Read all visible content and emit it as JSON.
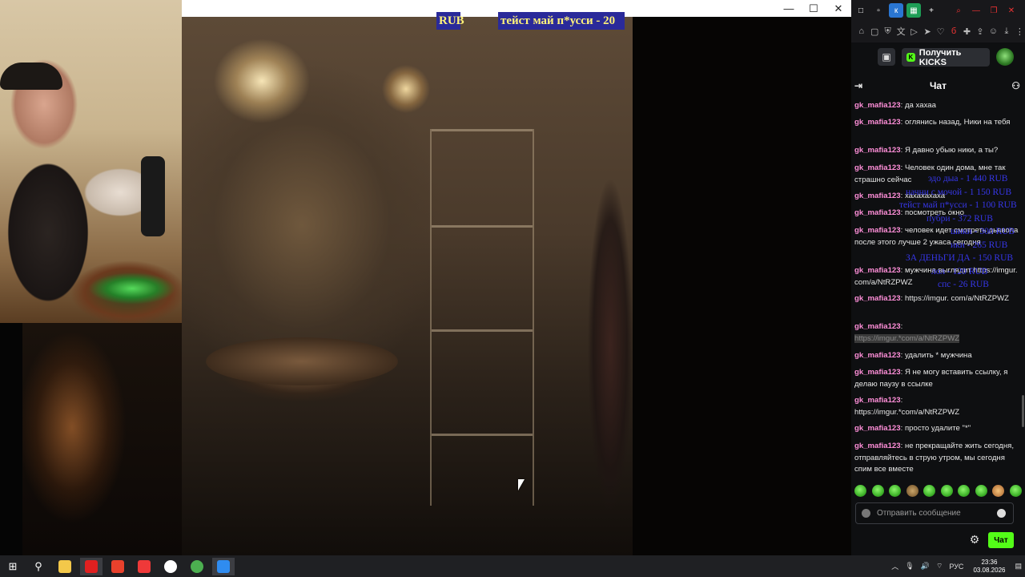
{
  "player": {
    "window_controls": {
      "minimize": "—",
      "maximize": "☐",
      "close": "✕"
    },
    "ticker_left": "RUB",
    "ticker_main": "тейст май п*усси - 20"
  },
  "browser": {
    "toolbar_icons": [
      "bookmark-icon",
      "screenshot-icon",
      "shield-icon",
      "translate-icon",
      "play-icon",
      "send-icon",
      "heart-icon",
      "b-extension-icon",
      "puzzle-icon",
      "share-icon",
      "profile-icon",
      "download-icon",
      "menu-icon"
    ]
  },
  "kick": {
    "get_kicks_label": "Получить KICKS"
  },
  "chat": {
    "title": "Чат",
    "username": "gk_mafia123",
    "messages": [
      {
        "user": "gk_mafia123",
        "text": "да хахаа"
      },
      {
        "user": "gk_mafia123",
        "text": "оглянись назад, Ники на тебя"
      },
      {
        "user": "gk_mafia123",
        "text": "Я давно убыю ники, а ты?"
      },
      {
        "user": "gk_mafia123",
        "text": "Человек один дома, мне так страшно сейчас"
      },
      {
        "user": "gk_mafia123",
        "text": "хахахахаха"
      },
      {
        "user": "gk_mafia123",
        "text": "посмотреть окно"
      },
      {
        "user": "gk_mafia123",
        "text": "человек идет смотреть дьявола после этого лучше 2 ужаса сегодня"
      },
      {
        "user": "gk_mafia123",
        "text": "мужчина выглядит https://imgur. com/a/NtRZPWZ"
      },
      {
        "user": "gk_mafia123",
        "text": "https://imgur. com/a/NtRZPWZ"
      },
      {
        "user": "gk_mafia123",
        "text": "",
        "link": "https://imgur.*com/a/NtRZPWZ"
      },
      {
        "user": "gk_mafia123",
        "text": "удалить * мужчина"
      },
      {
        "user": "gk_mafia123",
        "text": "Я не могу вставить ссылку, я делаю паузу в ссылке"
      },
      {
        "user": "gk_mafia123",
        "text": "https://imgur.*com/a/NtRZPWZ"
      },
      {
        "user": "gk_mafia123",
        "text": "просто удалите \"*\""
      },
      {
        "user": "gk_mafia123",
        "text": "не прекращайте жить сегодня, отправляйтесь в струю утром, мы сегодня спим все вместе"
      }
    ],
    "donation_overlay": [
      "эдо дыа - 1 440 RUB",
      "начни с мочой - 1 150 RUB",
      "тейст май п*усси - 1 100 RUB",
      "пубри - 372 RUB",
      "шики - 300 RUB",
      "ики - 265 RUB",
      "ЗА ДЕНЬГИ ДА - 150 RUB",
      "лол - 120 RUB",
      "спс - 26 RUB"
    ],
    "input_placeholder": "Отправить сообщение",
    "send_label": "Чат"
  },
  "taskbar": {
    "time": "23:36",
    "date": "03.08.2026",
    "lang": "РУС",
    "colors": {
      "red": "#e02020",
      "yandex": "#e8412c",
      "vivaldi": "#ef3939",
      "chrome": "#4caf50",
      "blue": "#2f8cf0"
    }
  }
}
